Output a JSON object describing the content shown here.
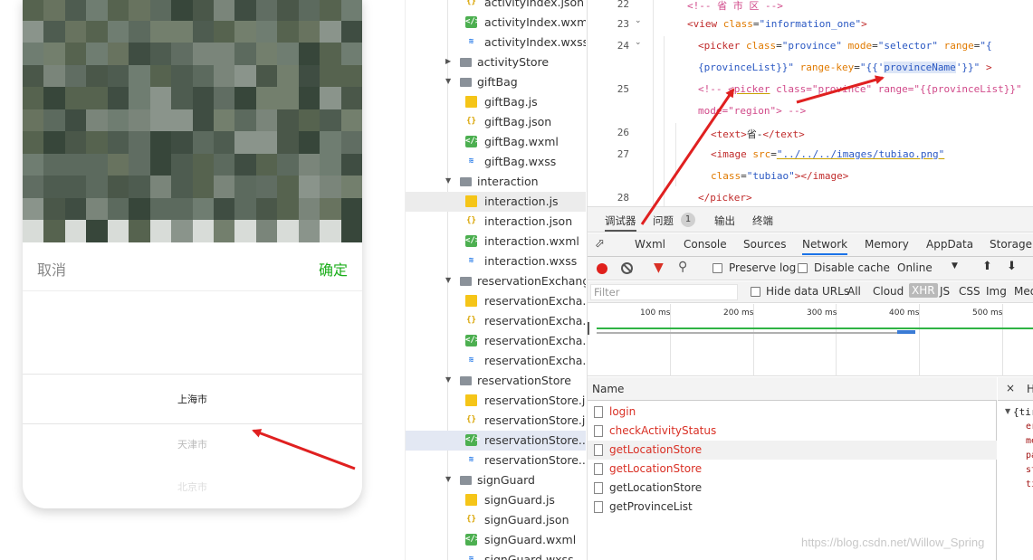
{
  "phone": {
    "cancel_label": "取消",
    "confirm_label": "确定",
    "picker_options": [
      "上海市",
      "天津市",
      "北京市"
    ],
    "accent_color": "#1aad19"
  },
  "file_tree": {
    "rows": [
      {
        "name": "activityIndex.json",
        "kind": "json",
        "depth": 2
      },
      {
        "name": "activityIndex.wxml",
        "kind": "wxml",
        "depth": 2
      },
      {
        "name": "activityIndex.wxss",
        "kind": "wxss",
        "depth": 2
      },
      {
        "name": "activityStore",
        "kind": "folder",
        "depth": 1,
        "expanded": false
      },
      {
        "name": "giftBag",
        "kind": "folder",
        "depth": 1,
        "expanded": true
      },
      {
        "name": "giftBag.js",
        "kind": "js",
        "depth": 2
      },
      {
        "name": "giftBag.json",
        "kind": "json",
        "depth": 2
      },
      {
        "name": "giftBag.wxml",
        "kind": "wxml",
        "depth": 2
      },
      {
        "name": "giftBag.wxss",
        "kind": "wxss",
        "depth": 2
      },
      {
        "name": "interaction",
        "kind": "folder",
        "depth": 1,
        "expanded": true
      },
      {
        "name": "interaction.js",
        "kind": "js",
        "depth": 2,
        "selected": true
      },
      {
        "name": "interaction.json",
        "kind": "json",
        "depth": 2
      },
      {
        "name": "interaction.wxml",
        "kind": "wxml",
        "depth": 2
      },
      {
        "name": "interaction.wxss",
        "kind": "wxss",
        "depth": 2
      },
      {
        "name": "reservationExchange",
        "kind": "folder",
        "depth": 1,
        "expanded": true
      },
      {
        "name": "reservationExcha...",
        "kind": "js",
        "depth": 2
      },
      {
        "name": "reservationExcha...",
        "kind": "json",
        "depth": 2
      },
      {
        "name": "reservationExcha...",
        "kind": "wxml",
        "depth": 2
      },
      {
        "name": "reservationExcha...",
        "kind": "wxss",
        "depth": 2
      },
      {
        "name": "reservationStore",
        "kind": "folder",
        "depth": 1,
        "expanded": true
      },
      {
        "name": "reservationStore.js",
        "kind": "js",
        "depth": 2
      },
      {
        "name": "reservationStore.j...",
        "kind": "json",
        "depth": 2
      },
      {
        "name": "reservationStore....",
        "kind": "wxml",
        "depth": 2,
        "active": true
      },
      {
        "name": "reservationStore....",
        "kind": "wxss",
        "depth": 2
      },
      {
        "name": "signGuard",
        "kind": "folder",
        "depth": 1,
        "expanded": true
      },
      {
        "name": "signGuard.js",
        "kind": "js",
        "depth": 2
      },
      {
        "name": "signGuard.json",
        "kind": "json",
        "depth": 2
      },
      {
        "name": "signGuard.wxml",
        "kind": "wxml",
        "depth": 2
      },
      {
        "name": "signGuard.wxss",
        "kind": "wxss",
        "depth": 2
      }
    ]
  },
  "editor": {
    "lines": [
      {
        "num": "22",
        "fold": false,
        "text": "<!-- 省 市 区 -->"
      },
      {
        "num": "23",
        "fold": true,
        "text": "<view class=\"information_one\">"
      },
      {
        "num": "24",
        "fold": true,
        "text": "<picker class=\"province\" mode=\"selector\" range=\"{"
      },
      {
        "num": "",
        "fold": false,
        "text": "{provinceList}}\" range-key=\"{{'provinceName'}}\" >"
      },
      {
        "num": "25",
        "fold": false,
        "text": "<!-- <picker class=\"province\" range=\"{{provinceList}}\""
      },
      {
        "num": "",
        "fold": false,
        "text": "mode=\"region\"> -->"
      },
      {
        "num": "26",
        "fold": false,
        "text": "<text>省-</text>"
      },
      {
        "num": "27",
        "fold": false,
        "text": "<image src=\"../../../images/tubiao.png\""
      },
      {
        "num": "",
        "fold": false,
        "text": "class=\"tubiao\"></image>"
      },
      {
        "num": "28",
        "fold": false,
        "text": "</picker>"
      }
    ]
  },
  "devtools": {
    "top_tabs": [
      "调试器",
      "问题",
      "输出",
      "终端"
    ],
    "issues_count": "1",
    "panel_tabs": [
      "Wxml",
      "Console",
      "Sources",
      "Network",
      "Memory",
      "AppData",
      "Storage"
    ],
    "active_panel": "Network",
    "preserve_log": "Preserve log",
    "disable_cache": "Disable cache",
    "throttle": "Online",
    "filter_placeholder": "Filter",
    "hide_data_urls": "Hide data URLs",
    "type_filters": [
      "All",
      "Cloud",
      "XHR",
      "JS",
      "CSS",
      "Img",
      "Med"
    ],
    "active_type": "XHR",
    "timeline_ticks": [
      "100 ms",
      "200 ms",
      "300 ms",
      "400 ms",
      "500 ms"
    ],
    "name_header": "Name",
    "requests": [
      {
        "name": "login",
        "error": true
      },
      {
        "name": "checkActivityStatus",
        "error": true
      },
      {
        "name": "getLocationStore",
        "error": true
      },
      {
        "name": "getLocationStore",
        "error": true
      },
      {
        "name": "getLocationStore",
        "error": false
      },
      {
        "name": "getProvinceList",
        "error": false
      }
    ],
    "detail_close": "×",
    "detail_tab": "H",
    "detail_json_open": "{tir",
    "detail_keys": [
      "er",
      "me",
      "pa",
      "st",
      "ti"
    ]
  },
  "watermark": "https://blog.csdn.net/Willow_Spring",
  "annotation_color": "#e02020"
}
